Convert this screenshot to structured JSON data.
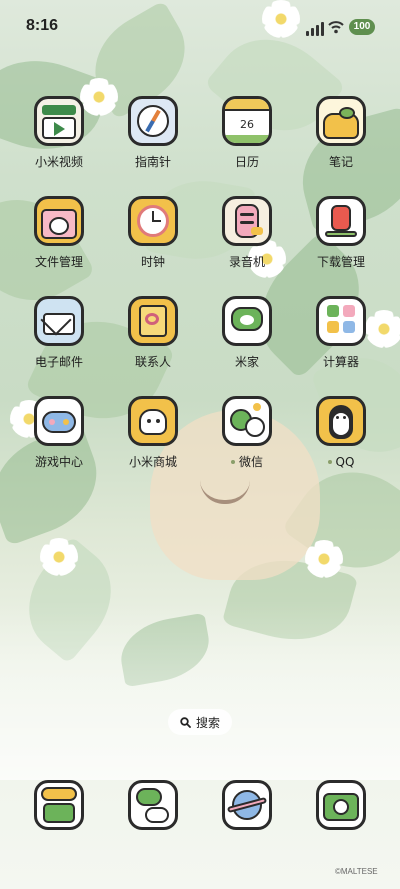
{
  "status_bar": {
    "time": "8:16",
    "battery": "100"
  },
  "apps": [
    {
      "label": "小米视频",
      "icon": "video-icon"
    },
    {
      "label": "指南针",
      "icon": "compass-icon"
    },
    {
      "label": "日历",
      "icon": "calendar-icon",
      "date": "26"
    },
    {
      "label": "笔记",
      "icon": "notes-icon"
    },
    {
      "label": "文件管理",
      "icon": "folder-icon"
    },
    {
      "label": "时钟",
      "icon": "clock-icon"
    },
    {
      "label": "录音机",
      "icon": "recorder-icon"
    },
    {
      "label": "下载管理",
      "icon": "download-icon"
    },
    {
      "label": "电子邮件",
      "icon": "mail-icon"
    },
    {
      "label": "联系人",
      "icon": "contacts-icon"
    },
    {
      "label": "米家",
      "icon": "mijia-icon"
    },
    {
      "label": "计算器",
      "icon": "calculator-icon"
    },
    {
      "label": "游戏中心",
      "icon": "game-center-icon"
    },
    {
      "label": "小米商城",
      "icon": "mi-store-icon"
    },
    {
      "label": "微信",
      "icon": "wechat-icon",
      "dot": true
    },
    {
      "label": "QQ",
      "icon": "qq-icon",
      "dot": true
    }
  ],
  "search": {
    "label": "搜索"
  },
  "dock": [
    {
      "icon": "phone-icon"
    },
    {
      "icon": "messages-icon"
    },
    {
      "icon": "browser-icon"
    },
    {
      "icon": "camera-icon"
    }
  ],
  "watermark": "©MALTESE",
  "colors": {
    "accent_green": "#5f8f4f",
    "icon_border": "#2b2b2b"
  }
}
